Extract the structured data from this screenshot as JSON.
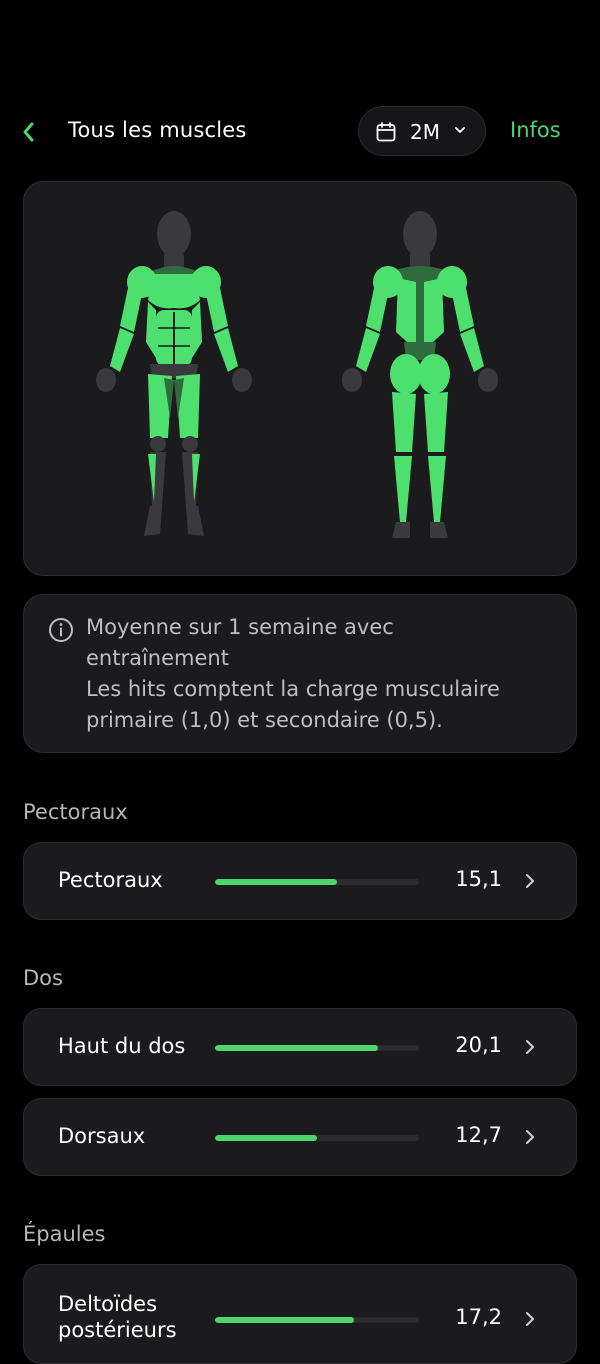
{
  "header": {
    "title": "Tous les muscles",
    "period_label": "2M",
    "infos_label": "Infos"
  },
  "colors": {
    "accent": "#4cd66c",
    "muscle_active": "#4ee06e",
    "muscle_dim": "#2f6b3c",
    "body_base": "#3a3a3e",
    "card_bg": "#1b1b1e"
  },
  "note": {
    "lines": [
      "Moyenne sur 1 semaine avec",
      "entraînement",
      "Les hits comptent la charge musculaire",
      "primaire (1,0) et secondaire (0,5)."
    ]
  },
  "sections": [
    {
      "title": "Pectoraux",
      "rows": [
        {
          "name": "Pectoraux",
          "value": "15,1",
          "fill": 0.6
        }
      ]
    },
    {
      "title": "Dos",
      "rows": [
        {
          "name": "Haut du dos",
          "value": "20,1",
          "fill": 0.8
        },
        {
          "name": "Dorsaux",
          "value": "12,7",
          "fill": 0.5
        }
      ]
    },
    {
      "title": "Épaules",
      "rows": [
        {
          "name": "Deltoïdes postérieurs",
          "value": "17,2",
          "fill": 0.68
        }
      ]
    }
  ]
}
